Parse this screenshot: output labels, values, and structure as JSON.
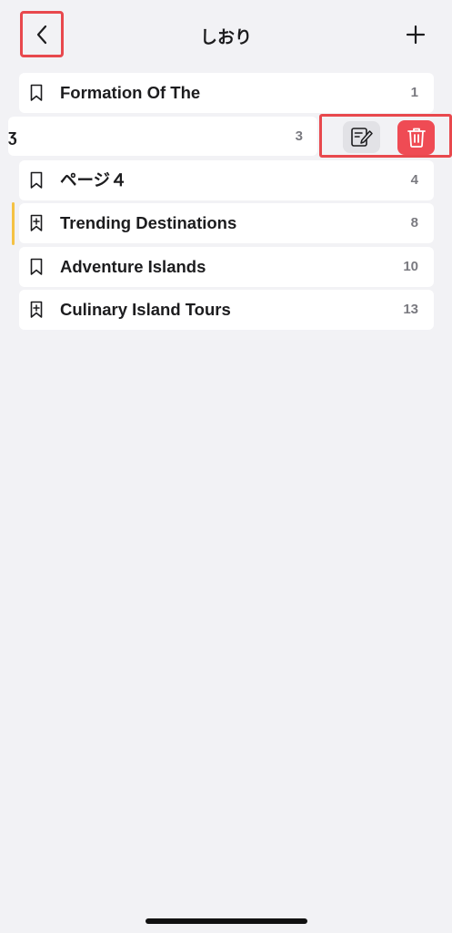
{
  "header": {
    "title": "しおり",
    "back_icon": "chevron-left-icon",
    "add_icon": "plus-icon"
  },
  "bookmarks": [
    {
      "label": "Formation Of The",
      "page": "1",
      "icon": "bookmark-icon"
    },
    {
      "label": "ページ４",
      "page": "4",
      "icon": "bookmark-icon"
    },
    {
      "label": "Trending Destinations",
      "page": "8",
      "icon": "bookmark-plus-icon",
      "current": true
    },
    {
      "label": "Adventure Islands",
      "page": "10",
      "icon": "bookmark-icon"
    },
    {
      "label": "Culinary Island Tours",
      "page": "13",
      "icon": "bookmark-plus-icon"
    }
  ],
  "swiped_row": {
    "partial_text": "3",
    "page": "3",
    "actions": {
      "edit_icon": "edit-icon",
      "delete_icon": "trash-icon"
    }
  },
  "colors": {
    "accent_red": "#ef4b54",
    "current_marker": "#f5c244",
    "highlight_box": "#e8484d"
  }
}
